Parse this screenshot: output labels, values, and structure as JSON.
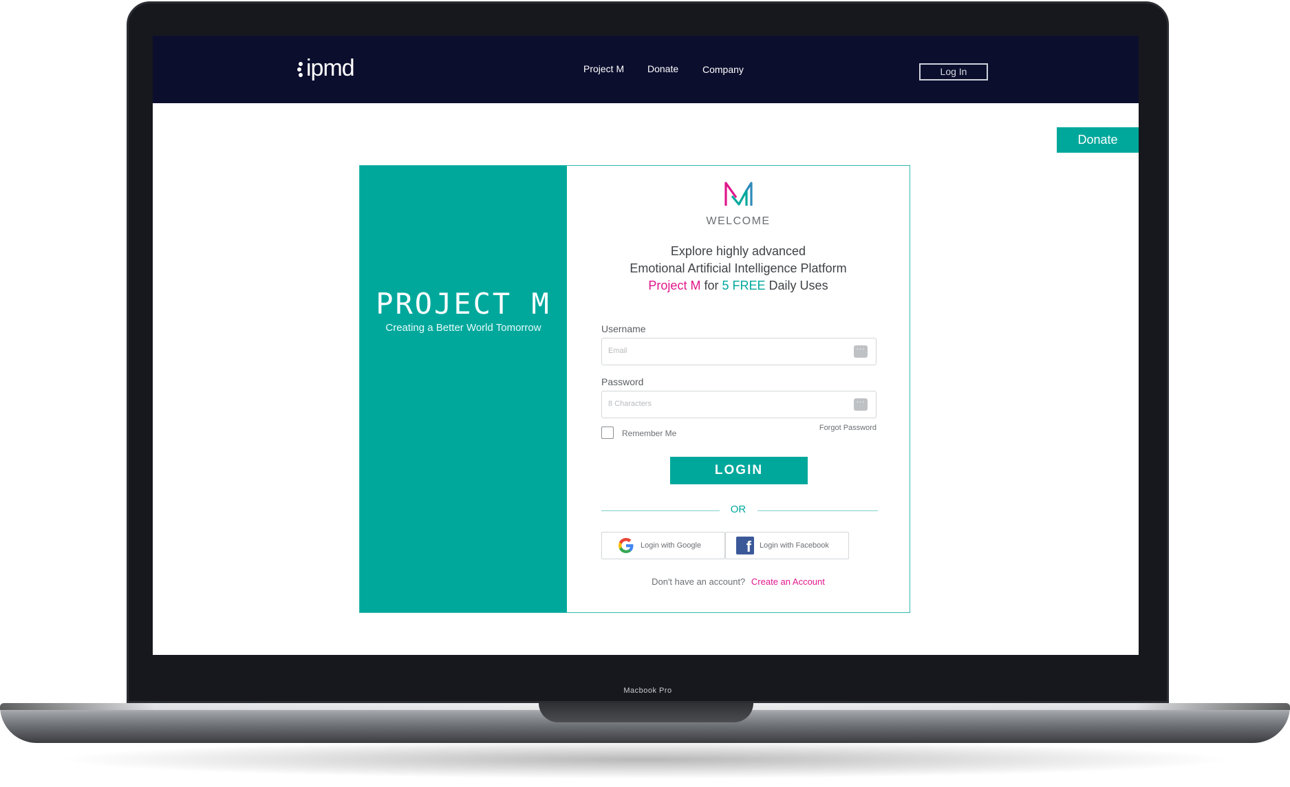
{
  "device": {
    "label": "Macbook Pro"
  },
  "nav": {
    "brand": "ipmd",
    "links": [
      "Project M",
      "Donate",
      "Company"
    ],
    "login_label": "Log In"
  },
  "donate_tab": {
    "label": "Donate"
  },
  "hero": {
    "title": "PROJECT M",
    "tagline": "Creating a Better World Tomorrow"
  },
  "login_card": {
    "welcome": "WELCOME",
    "headline_line1": "Explore highly advanced",
    "headline_line2": "Emotional Artificial Intelligence Platform",
    "headline_project": "Project M",
    "headline_for": "for",
    "headline_free": "5 FREE",
    "headline_tail": "Daily Uses",
    "username_label": "Username",
    "username_placeholder": "Email",
    "password_label": "Password",
    "password_placeholder": "8 Characters",
    "remember_label": "Remember Me",
    "forgot_label": "Forgot Password",
    "login_button": "LOGIN",
    "or_text": "OR",
    "google_label": "Login with Google",
    "facebook_label": "Login with Facebook",
    "no_account_text": "Don't have an account?",
    "create_account_label": "Create an Account"
  },
  "colors": {
    "nav_bg": "#0c0e2e",
    "accent_teal": "#00a89c",
    "accent_pink": "#e0168a"
  }
}
